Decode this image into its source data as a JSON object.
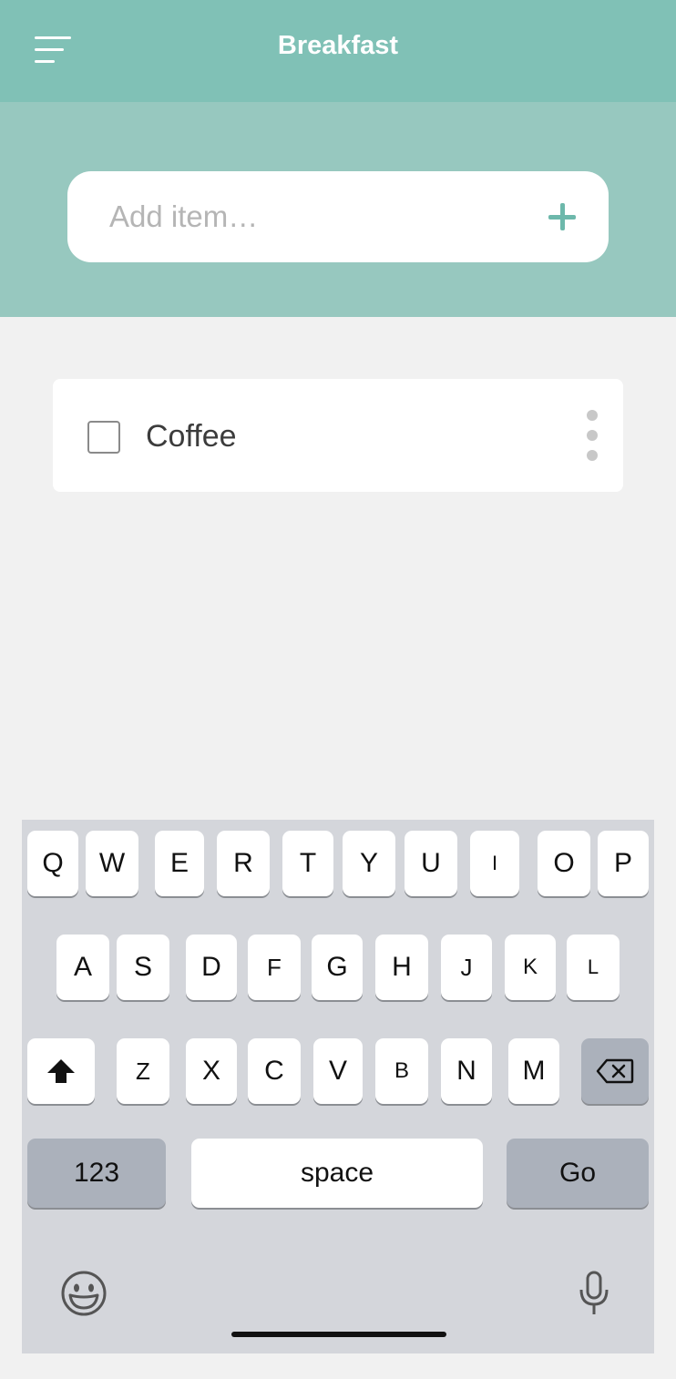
{
  "header": {
    "title": "Breakfast",
    "menu_icon": "menu-icon"
  },
  "add_item": {
    "placeholder": "Add item…",
    "add_icon": "plus-icon"
  },
  "list": {
    "items": [
      {
        "label": "Coffee",
        "checked": false,
        "more_icon": "more-vertical-icon"
      }
    ]
  },
  "keyboard": {
    "row1": [
      "Q",
      "W",
      "E",
      "R",
      "T",
      "Y",
      "U",
      "I",
      "O",
      "P"
    ],
    "row2": [
      "A",
      "S",
      "D",
      "F",
      "G",
      "H",
      "J",
      "K",
      "L"
    ],
    "row3": [
      "Z",
      "X",
      "C",
      "V",
      "B",
      "N",
      "M"
    ],
    "shift_icon": "shift-icon",
    "delete_icon": "backspace-icon",
    "numbers_label": "123",
    "space_label": "space",
    "go_label": "Go",
    "emoji_icon": "emoji-icon",
    "mic_icon": "microphone-icon"
  },
  "colors": {
    "header": "#80c1b6",
    "hero": "#97c8bf",
    "accent": "#6db8ab",
    "keyboard_bg": "#d4d6db",
    "dark_key": "#abb1bb"
  }
}
